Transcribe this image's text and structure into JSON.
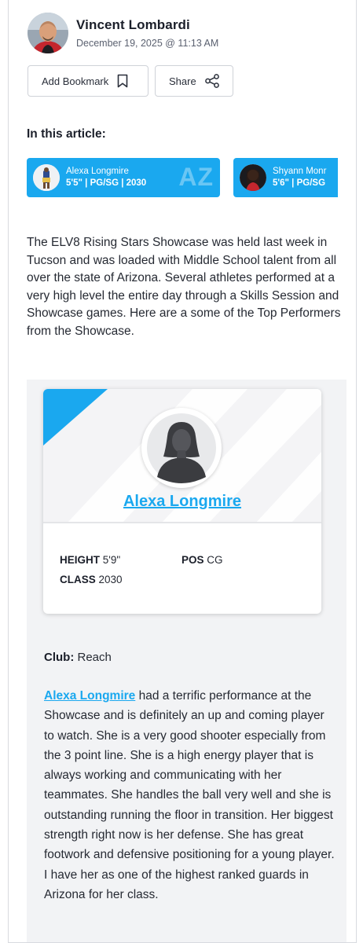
{
  "author": {
    "name": "Vincent Lombardi",
    "date": "December 19, 2025 @ 11:13 AM"
  },
  "actions": {
    "bookmark_label": "Add Bookmark",
    "share_label": "Share"
  },
  "in_article": {
    "heading": "In this article:",
    "players": [
      {
        "name": "Alexa Longmire",
        "details": "5'5\" | PG/SG | 2030",
        "state": "AZ"
      },
      {
        "name": "Shyann Monr",
        "details": "5'6\" | PG/SG"
      }
    ]
  },
  "intro": "The ELV8 Rising Stars Showcase was held last week in Tucson and was loaded with Middle School talent from all over the state of Arizona. Several athletes performed at a very high level the entire day through a Skills Session and Showcase games. Here are a some of the Top Performers from the Showcase.",
  "profile_card": {
    "name": "Alexa Longmire",
    "height_label": "HEIGHT",
    "height_value": "5'9\"",
    "pos_label": "POS",
    "pos_value": "CG",
    "class_label": "CLASS",
    "class_value": "2030"
  },
  "club": {
    "label": "Club:",
    "value": "Reach"
  },
  "body": {
    "player_link": "Alexa Longmire",
    "text": " had a terrific performance at the Showcase and is definitely an up and coming player to watch. She is a very good shooter especially from the 3 point line. She is a high energy player that is always working and communicating with her teammates. She handles the ball very well and she is outstanding running the floor in transition. Her biggest strength right now is her defense. She has great footwork and defensive positioning for a young player. I have her as one of the highest ranked guards in Arizona for her class."
  },
  "colors": {
    "accent": "#1aa8ef",
    "text": "#262a33",
    "panel": "#f2f3f5"
  }
}
